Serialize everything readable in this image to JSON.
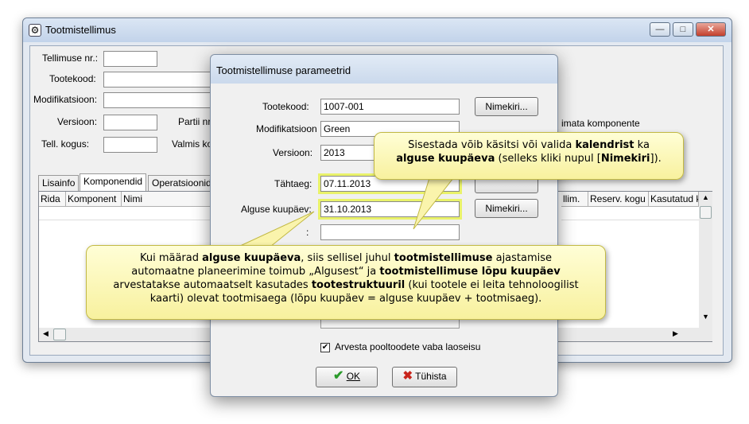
{
  "main_window": {
    "title": "Tootmistellimus",
    "controls": {
      "minimize": "—",
      "maximize": "□",
      "close": "✕"
    },
    "labels": {
      "order_no": "Tellimuse nr.:",
      "product_code": "Tootekood:",
      "modification": "Modifikatsioon:",
      "version": "Versioon:",
      "batch": "Partii nr",
      "order_qty": "Tell. kogus:",
      "ready": "Valmis ko",
      "missing_components": "imata komponente"
    },
    "tabs": [
      "Lisainfo",
      "Komponendid",
      "Operatsioonid"
    ],
    "grid": {
      "columns_left": [
        "Rida",
        "Komponent",
        "Nimi"
      ],
      "columns_right": [
        "llim.",
        "Reserv. kogu",
        "Kasutatud k"
      ]
    }
  },
  "dialog": {
    "title": "Tootmistellimuse parameetrid",
    "fields": [
      {
        "label": "Tootekood:",
        "value": "1007-001",
        "button": "Nimekiri..."
      },
      {
        "label": "Modifikatsioon",
        "value": "Green"
      },
      {
        "label": "Versioon:",
        "value": "2013"
      },
      {
        "label": "Tähtaeg:",
        "value": "07.11.2013"
      },
      {
        "label": "Alguse kuupäev:",
        "value": "31.10.2013",
        "button": "Nimekiri..."
      },
      {
        "label": ":",
        "value": ""
      }
    ],
    "checkbox": {
      "label": "Arvesta pooltoodete vaba laoseisu",
      "checked": true
    },
    "ok_label": "OK",
    "cancel_label": "Tühista"
  },
  "callouts": {
    "top": [
      [
        {
          "t": "Sisestada võib käsitsi või valida "
        },
        {
          "t": "kalendrist",
          "b": true
        },
        {
          "t": " ka"
        }
      ],
      [
        {
          "t": "alguse kuupäeva",
          "b": true
        },
        {
          "t": " (selleks kliki nupul ["
        },
        {
          "t": "Nimekiri",
          "b": true
        },
        {
          "t": "])."
        }
      ]
    ],
    "bottom": [
      [
        {
          "t": "Kui määrad "
        },
        {
          "t": "alguse kuupäeva",
          "b": true
        },
        {
          "t": ", siis sellisel juhul "
        },
        {
          "t": "tootmistellimuse",
          "b": true
        },
        {
          "t": " ajastamise"
        }
      ],
      [
        {
          "t": "automaatne planeerimine toimub „Algusest“ ja "
        },
        {
          "t": "tootmistellimuse lõpu kuupäev",
          "b": true
        }
      ],
      [
        {
          "t": "arvestatakse automaatselt kasutades "
        },
        {
          "t": "tootestruktuuril",
          "b": true
        },
        {
          "t": " (kui tootele ei leita tehnoloogilist"
        }
      ],
      [
        {
          "t": "kaarti) olevat tootmisaega (lõpu kuupäev = alguse kuupäev + tootmisaeg)."
        }
      ]
    ]
  },
  "colors": {
    "highlight": "#e9f26a",
    "callout_bg": "#fbf6b8",
    "ok_check": "#2a9a2a",
    "cancel_x": "#c8241b"
  }
}
